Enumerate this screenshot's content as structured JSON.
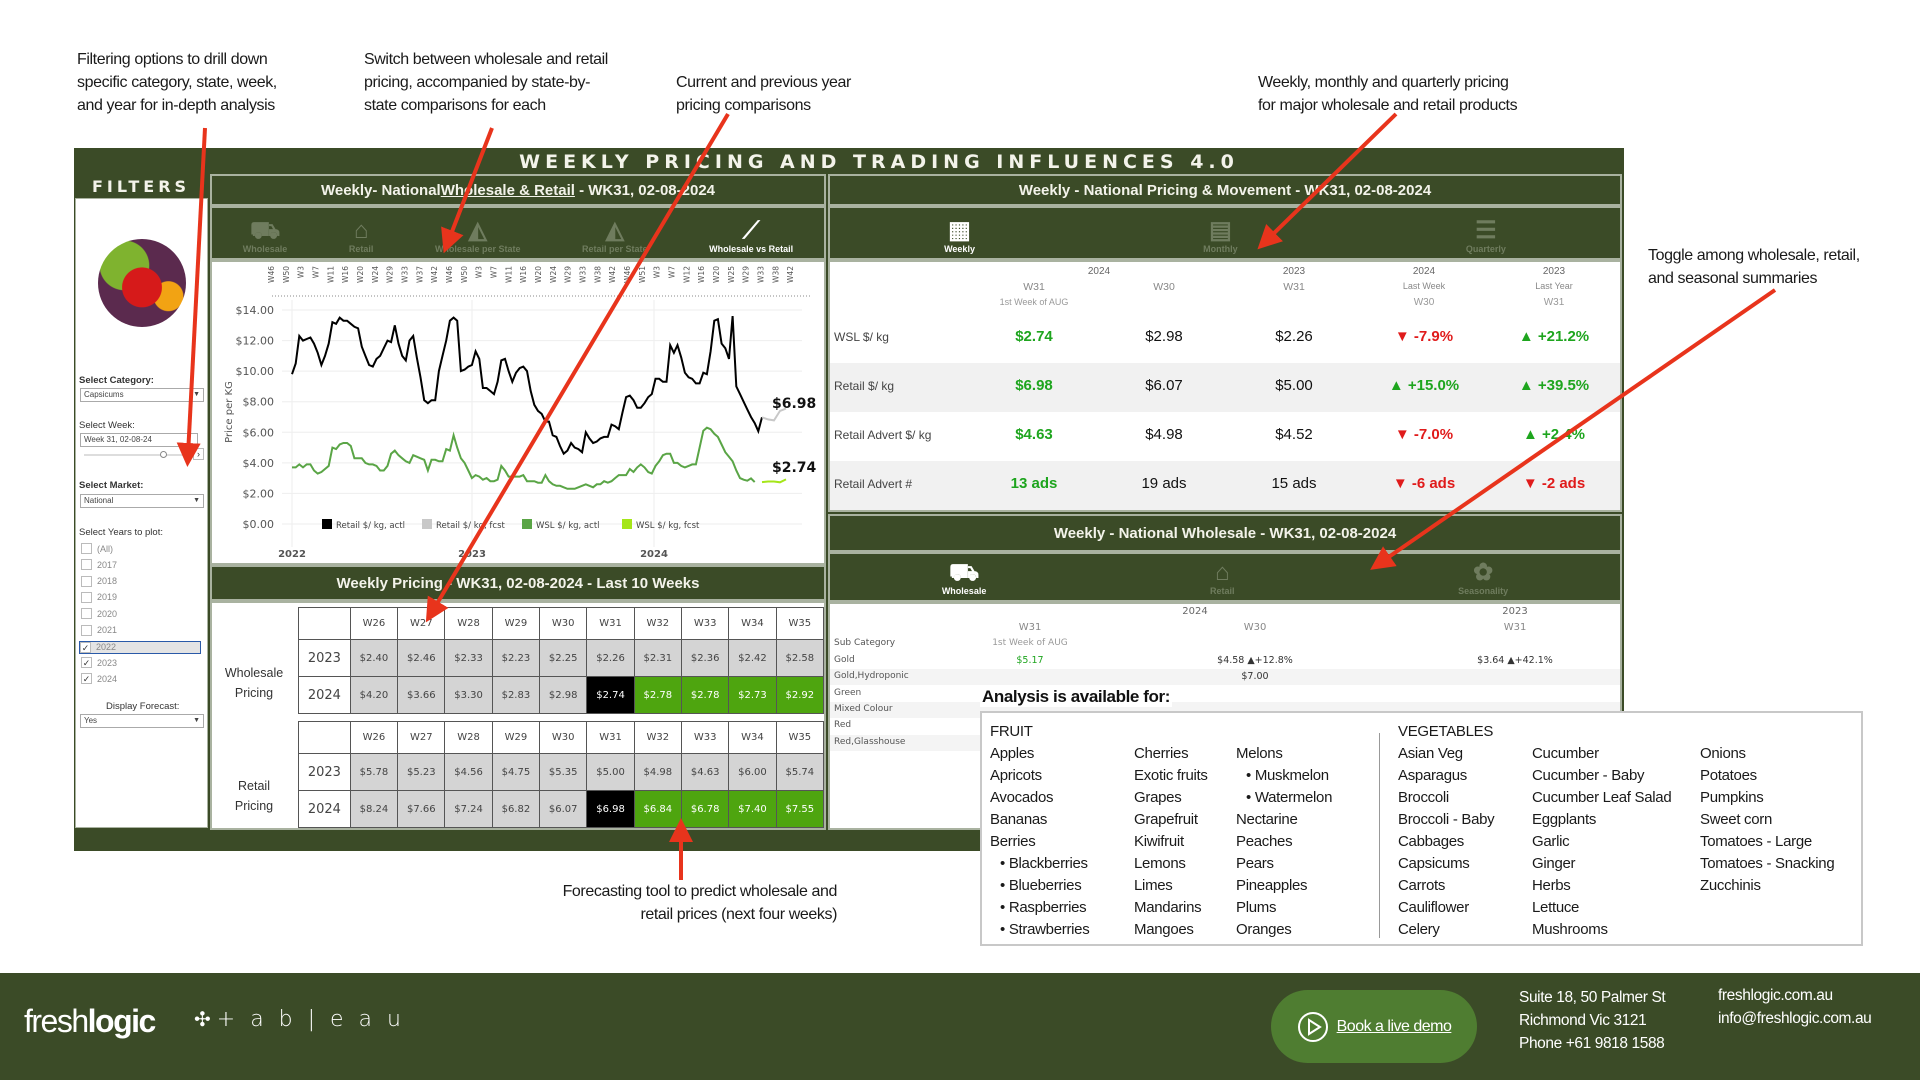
{
  "annotations": {
    "filters": [
      "Filtering options to drill down",
      "specific category, state, week,",
      "and year for in-depth analysis"
    ],
    "switch": [
      "Switch between wholesale and retail",
      "pricing, accompanied by state-by-",
      "state comparisons for each"
    ],
    "current": [
      "Current and  previous  year",
      "pricing comparisons"
    ],
    "weekly": [
      "Weekly, monthly and quarterly pricing",
      "for major wholesale and retail products"
    ],
    "toggle": [
      "Toggle among wholesale, retail,",
      "and seasonal summaries"
    ],
    "forecast": [
      "Forecasting tool to predict wholesale and",
      "retail prices (next four weeks)"
    ]
  },
  "dashboard": {
    "title": "WEEKLY PRICING AND TRADING INFLUENCES 4.0",
    "colors": {
      "dark_green": "#3b4b27",
      "forecast_green": "#4ea50f",
      "current_black": "#000000",
      "up": "#1ea51e",
      "down": "#e01b1b"
    }
  },
  "filters": {
    "title": "FILTERS",
    "category_label": "Select Category:",
    "category_value": "Capsicums",
    "week_label": "Select Week:",
    "week_value": "Week 31, 02-08-24",
    "market_label": "Select Market:",
    "market_value": "National",
    "years_label": "Select Years to plot:",
    "years": [
      {
        "label": "(All)",
        "checked": false
      },
      {
        "label": "2017",
        "checked": false
      },
      {
        "label": "2018",
        "checked": false
      },
      {
        "label": "2019",
        "checked": false
      },
      {
        "label": "2020",
        "checked": false
      },
      {
        "label": "2021",
        "checked": false
      },
      {
        "label": "2022",
        "checked": true
      },
      {
        "label": "2023",
        "checked": true
      },
      {
        "label": "2024",
        "checked": true
      }
    ],
    "forecast_label": "Display Forecast:",
    "forecast_value": "Yes"
  },
  "wsl_retail_panel": {
    "title_prefix": "Weekly- National ",
    "title_link": "Wholesale & Retail",
    "title_suffix": " - WK31, 02-08-2024",
    "tabs": [
      {
        "label": "Wholesale",
        "icon": "forklift-dollar-icon",
        "active": false
      },
      {
        "label": "Retail",
        "icon": "basket-icon",
        "active": false
      },
      {
        "label": "Wholesale per State",
        "icon": "australia-map-icon",
        "active": false
      },
      {
        "label": "Retail per State",
        "icon": "australia-map-icon",
        "active": false
      },
      {
        "label": "Wholesale vs Retail",
        "icon": "line-chart-icon",
        "active": true
      }
    ]
  },
  "chart_data": {
    "type": "line",
    "title": "",
    "xlabel": "",
    "ylabel": "Price per KG",
    "ylim": [
      0,
      14
    ],
    "yticks": [
      "$14.00",
      "$12.00",
      "$10.00",
      "$8.00",
      "$6.00",
      "$4.00",
      "$2.00",
      "$0.00"
    ],
    "year_labels": [
      "2022",
      "2023",
      "2024"
    ],
    "week_ticks": [
      "W46",
      "W50",
      "W3",
      "W7",
      "W11",
      "W16",
      "W20",
      "W24",
      "W29",
      "W33",
      "W37",
      "W42",
      "W46",
      "W50",
      "W3",
      "W7",
      "W11",
      "W16",
      "W20",
      "W24",
      "W29",
      "W33",
      "W38",
      "W42",
      "W46",
      "W51",
      "W3",
      "W7",
      "W12",
      "W16",
      "W20",
      "W25",
      "W29",
      "W33",
      "W38",
      "W42"
    ],
    "grid": true,
    "legend_position": "bottom",
    "end_labels": {
      "retail": "$6.98",
      "wsl": "$2.74"
    },
    "series": [
      {
        "name": "Retail $/ kg, actl",
        "color": "#000000",
        "values": [
          9.8,
          10.5,
          12.3,
          12.0,
          12.1,
          12.2,
          11.8,
          11.2,
          10.4,
          11.0,
          11.8,
          13.2,
          13.1,
          13.5,
          13.3,
          13.3,
          13.1,
          12.9,
          12.8,
          11.6,
          11.0,
          10.4,
          10.3,
          10.8,
          11.0,
          11.5,
          12.0,
          11.9,
          13.0,
          11.8,
          11.0,
          10.7,
          12.0,
          12.3,
          10.9,
          9.6,
          8.1,
          7.9,
          8.1,
          8.1,
          10.0,
          11.0,
          12.0,
          13.3,
          13.5,
          13.3,
          10.0,
          10.1,
          10.3,
          10.4,
          11.3,
          10.8,
          8.9,
          8.9,
          8.7,
          8.5,
          9.3,
          10.7,
          10.8,
          10.0,
          9.3,
          9.9,
          10.2,
          10.3,
          10.0,
          8.7,
          7.8,
          7.4,
          7.2,
          6.7,
          6.7,
          5.8,
          5.7,
          5.1,
          4.6,
          4.8,
          5.3,
          5.0,
          4.9,
          4.7,
          6.0,
          5.6,
          5.3,
          5.4,
          5.6,
          5.7,
          5.7,
          6.5,
          6.4,
          6.2,
          7.3,
          8.3,
          8.4,
          8.1,
          7.6,
          7.6,
          7.9,
          8.3,
          8.5,
          9.5,
          9.5,
          9.3,
          9.3,
          11.7,
          11.2,
          11.7,
          10.9,
          9.9,
          9.6,
          9.5,
          9.2,
          9.2,
          9.9,
          9.8,
          11.3,
          13.3,
          13.4,
          11.8,
          11.5,
          10.8,
          13.6,
          9.0,
          8.5,
          8.0,
          7.5,
          7.0,
          6.6,
          6.07,
          6.98
        ]
      },
      {
        "name": "Retail $/ kg, fcst",
        "color": "#c8c8c8",
        "values": [
          6.98,
          6.84,
          6.78,
          7.4,
          7.55
        ]
      },
      {
        "name": "WSL $/ kg, actl",
        "color": "#5aa546",
        "values": [
          3.7,
          3.7,
          3.9,
          3.7,
          3.9,
          3.9,
          3.5,
          3.3,
          3.4,
          3.6,
          3.8,
          5.0,
          4.9,
          5.2,
          5.3,
          5.3,
          5.1,
          4.3,
          4.3,
          4.3,
          4.0,
          3.9,
          3.9,
          3.8,
          3.5,
          3.5,
          3.8,
          4.6,
          4.8,
          4.5,
          4.3,
          4.1,
          4.0,
          4.5,
          4.4,
          4.3,
          4.2,
          3.5,
          4.2,
          4.2,
          4.1,
          4.1,
          4.9,
          4.8,
          5.8,
          5.0,
          4.3,
          4.0,
          3.5,
          3.0,
          3.2,
          3.1,
          2.9,
          3.0,
          2.8,
          2.8,
          2.9,
          3.8,
          3.5,
          3.1,
          3.1,
          3.1,
          3.1,
          3.2,
          2.8,
          2.8,
          2.8,
          2.7,
          2.7,
          3.2,
          2.8,
          2.6,
          2.5,
          2.5,
          2.4,
          2.3,
          2.3,
          2.3,
          2.4,
          2.5,
          2.6,
          2.5,
          2.4,
          2.6,
          2.6,
          2.8,
          2.7,
          2.8,
          3.0,
          3.2,
          3.2,
          3.2,
          3.6,
          3.4,
          3.7,
          3.9,
          3.7,
          3.4,
          3.3,
          3.8,
          4.1,
          4.5,
          4.6,
          4.6,
          4.0,
          4.0,
          3.8,
          3.7,
          3.8,
          3.9,
          3.9,
          5.0,
          6.1,
          6.3,
          6.2,
          5.9,
          5.7,
          5.2,
          4.7,
          4.4,
          4.1,
          3.5,
          3.0,
          2.9,
          2.83,
          2.98,
          2.74
        ]
      },
      {
        "name": "WSL $/ kg, fcst",
        "color": "#a5e619",
        "values": [
          2.74,
          2.78,
          2.78,
          2.73,
          2.92
        ]
      }
    ]
  },
  "last10": {
    "title": "Weekly Pricing - WK31, 02-08-2024 - Last 10 Weeks",
    "weeks": [
      "W26",
      "W27",
      "W28",
      "W29",
      "W30",
      "W31",
      "W32",
      "W33",
      "W34",
      "W35"
    ],
    "current_index": 5,
    "forecast_from_index": 6,
    "wholesale": {
      "label": [
        "Wholesale",
        "Pricing"
      ],
      "rows": [
        {
          "year": "2023",
          "values": [
            "$2.40",
            "$2.46",
            "$2.33",
            "$2.23",
            "$2.25",
            "$2.26",
            "$2.31",
            "$2.36",
            "$2.42",
            "$2.58"
          ]
        },
        {
          "year": "2024",
          "values": [
            "$4.20",
            "$3.66",
            "$3.30",
            "$2.83",
            "$2.98",
            "$2.74",
            "$2.78",
            "$2.78",
            "$2.73",
            "$2.92"
          ]
        }
      ]
    },
    "retail": {
      "label": [
        "Retail",
        "Pricing"
      ],
      "rows": [
        {
          "year": "2023",
          "values": [
            "$5.78",
            "$5.23",
            "$4.56",
            "$4.75",
            "$5.35",
            "$5.00",
            "$4.98",
            "$4.63",
            "$6.00",
            "$5.74"
          ]
        },
        {
          "year": "2024",
          "values": [
            "$8.24",
            "$7.66",
            "$7.24",
            "$6.82",
            "$6.07",
            "$6.98",
            "$6.84",
            "$6.78",
            "$7.40",
            "$7.55"
          ]
        }
      ]
    }
  },
  "pricing_movement": {
    "title": "Weekly - National Pricing & Movement - WK31, 02-08-2024",
    "tabs": [
      {
        "label": "Weekly",
        "icon": "calendar-week-icon",
        "active": true
      },
      {
        "label": "Monthly",
        "icon": "calendar-month-icon",
        "active": false
      },
      {
        "label": "Quarterly",
        "icon": "quarterly-list-icon",
        "active": false
      }
    ],
    "columns": [
      {
        "year": "2024",
        "week": "W31",
        "sub": "1st Week of AUG"
      },
      {
        "year": "",
        "week": "W30",
        "sub": ""
      },
      {
        "year": "2023",
        "week": "W31",
        "sub": ""
      },
      {
        "year": "2024",
        "week": "Last Week",
        "sub": "W30"
      },
      {
        "year": "2023",
        "week": "Last Year",
        "sub": "W31"
      }
    ],
    "rows": [
      {
        "label": "WSL $/ kg",
        "cur": "$2.74",
        "prev": "$2.98",
        "ly": "$2.26",
        "wow": {
          "dir": "down",
          "text": "-7.9%"
        },
        "yoy": {
          "dir": "up",
          "text": "+21.2%"
        }
      },
      {
        "label": "Retail $/ kg",
        "cur": "$6.98",
        "prev": "$6.07",
        "ly": "$5.00",
        "wow": {
          "dir": "up",
          "text": "+15.0%"
        },
        "yoy": {
          "dir": "up",
          "text": "+39.5%"
        }
      },
      {
        "label": "Retail Advert $/ kg",
        "cur": "$4.63",
        "prev": "$4.98",
        "ly": "$4.52",
        "wow": {
          "dir": "down",
          "text": "-7.0%"
        },
        "yoy": {
          "dir": "up",
          "text": "+2.4%"
        }
      },
      {
        "label": "Retail Advert #",
        "cur": "13 ads",
        "prev": "19 ads",
        "ly": "15 ads",
        "wow": {
          "dir": "down",
          "text": "-6 ads"
        },
        "yoy": {
          "dir": "down",
          "text": "-2 ads"
        }
      }
    ]
  },
  "national_wholesale": {
    "title": "Weekly - National Wholesale - WK31, 02-08-2024",
    "tabs": [
      {
        "label": "Wholesale",
        "icon": "forklift-dollar-icon",
        "active": true
      },
      {
        "label": "Retail",
        "icon": "basket-icon",
        "active": false
      },
      {
        "label": "Seasonality",
        "icon": "seasonality-icon",
        "active": false
      }
    ],
    "header": {
      "y2024": "2024",
      "y2023": "2023",
      "w31": "W31",
      "sub": "1st Week of AUG",
      "w30": "W30",
      "w31b": "W31",
      "subcat": "Sub Category"
    },
    "rows": [
      {
        "name": "Gold",
        "cur": "$5.17",
        "prev": "$4.58",
        "prev_chg": "▲+12.8%",
        "ly": "$3.64",
        "ly_chg": "▲+42.1%"
      },
      {
        "name": "Gold,Hydroponic",
        "cur": "",
        "prev": "$7.00",
        "prev_chg": "",
        "ly": "",
        "ly_chg": ""
      },
      {
        "name": "Green",
        "cur": "",
        "prev": "",
        "prev_chg": "",
        "ly": "",
        "ly_chg": ""
      },
      {
        "name": "Mixed Colour",
        "cur": "",
        "prev": "",
        "prev_chg": "",
        "ly": "",
        "ly_chg": ""
      },
      {
        "name": "Red",
        "cur": "",
        "prev": "",
        "prev_chg": "",
        "ly": "",
        "ly_chg": ""
      },
      {
        "name": "Red,Glasshouse",
        "cur": "",
        "prev": "",
        "prev_chg": "",
        "ly": "",
        "ly_chg": ""
      }
    ]
  },
  "availability": {
    "title": "Analysis is available for:",
    "fruit_heading": "FRUIT",
    "fruit_cols": [
      [
        "Apples",
        "Apricots",
        "Avocados",
        "Bananas",
        "Berries",
        "• Blackberries",
        "• Blueberries",
        "• Raspberries",
        "• Strawberries"
      ],
      [
        "Cherries",
        "Exotic fruits",
        "Grapes",
        "Grapefruit",
        "Kiwifruit",
        "Lemons",
        "Limes",
        "Mandarins",
        "Mangoes"
      ],
      [
        "Melons",
        "• Muskmelon",
        "• Watermelon",
        "Nectarine",
        "Peaches",
        "Pears",
        "Pineapples",
        "Plums",
        "Oranges"
      ]
    ],
    "veg_heading": "VEGETABLES",
    "veg_cols": [
      [
        "Asian Veg",
        "Asparagus",
        "Broccoli",
        "Broccoli - Baby",
        "Cabbages",
        "Capsicums",
        "Carrots",
        "Cauliflower",
        "Celery"
      ],
      [
        "Cucumber",
        "Cucumber - Baby",
        "Cucumber Leaf Salad",
        "Eggplants",
        "Garlic",
        "Ginger",
        "Herbs",
        "Lettuce",
        "Mushrooms"
      ],
      [
        "Onions",
        "Potatoes",
        "Pumpkins",
        "Sweet corn",
        "Tomatoes - Large",
        "Tomatoes - Snacking",
        "Zucchinis"
      ]
    ]
  },
  "footer": {
    "logo_light": "fresh",
    "logo_bold": "logic",
    "partner": "+ a b | e a u",
    "demo_button": "Book a live demo",
    "address": [
      "Suite 18,  50 Palmer St",
      "Richmond Vic 3121",
      "Phone +61 9818 1588"
    ],
    "web": "freshlogic.com.au",
    "email": "info@freshlogic.com.au"
  }
}
